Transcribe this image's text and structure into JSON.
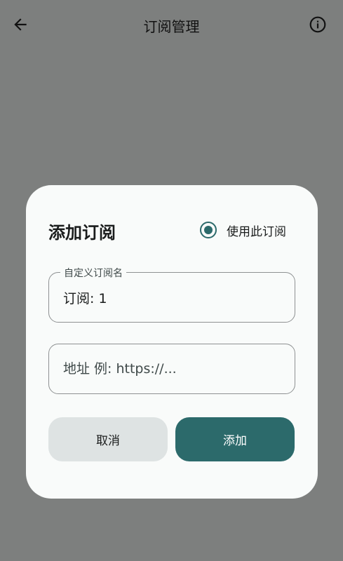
{
  "appbar": {
    "title": "订阅管理",
    "back_icon": "arrow-left-icon",
    "info_icon": "info-icon"
  },
  "dialog": {
    "title": "添加订阅",
    "use_toggle": {
      "label": "使用此订阅",
      "checked": true
    },
    "name_field": {
      "label": "自定义订阅名",
      "value": "订阅: 1"
    },
    "url_field": {
      "placeholder": "地址 例: https://...",
      "value": ""
    },
    "cancel_label": "取消",
    "add_label": "添加"
  },
  "colors": {
    "scrim": "#7d7f7e",
    "dialog_bg": "#f9fbfa",
    "primary": "#2c6a6b",
    "secondary_button": "#dee3e3"
  }
}
